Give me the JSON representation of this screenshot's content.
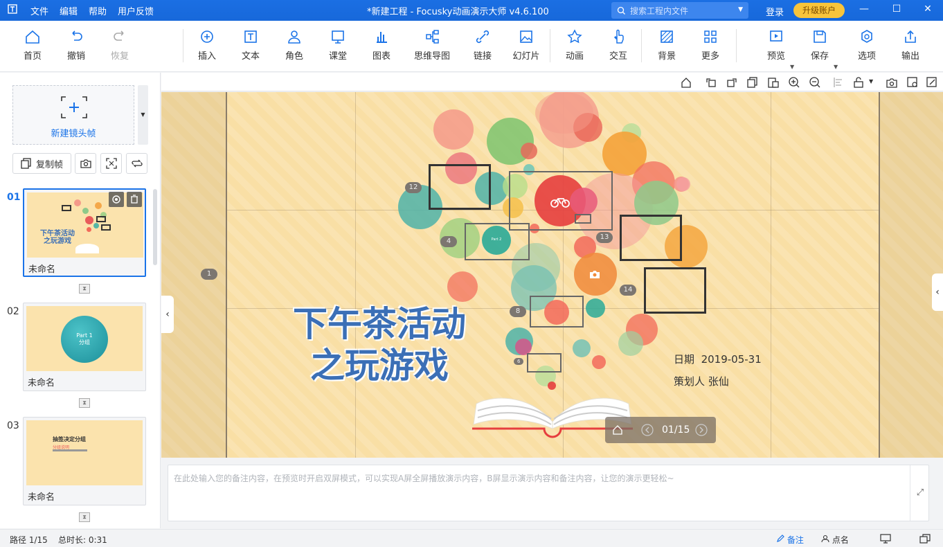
{
  "app": {
    "title": "*新建工程 - Focusky动画演示大师  v4.6.100",
    "menus": [
      "文件",
      "编辑",
      "帮助",
      "用户反馈"
    ],
    "search_placeholder": "搜索工程内文件",
    "login": "登录",
    "upgrade": "升级账户"
  },
  "toolbar": {
    "home": "首页",
    "undo": "撤销",
    "redo": "恢复",
    "insert": "插入",
    "text": "文本",
    "role": "角色",
    "class": "课堂",
    "chart": "图表",
    "mindmap": "思维导图",
    "link": "链接",
    "slides": "幻灯片",
    "animation": "动画",
    "interact": "交互",
    "background": "背景",
    "more": "更多",
    "preview": "预览",
    "save": "保存",
    "options": "选项",
    "export": "输出"
  },
  "left_panel": {
    "new_frame": "新建镜头帧",
    "copy_frame": "复制帧",
    "slides": [
      {
        "num": "01",
        "name": "未命名",
        "thumb_title_1": "下午茶活动",
        "thumb_title_2": "之玩游戏"
      },
      {
        "num": "02",
        "name": "未命名",
        "thumb_title_1": "Part 1",
        "thumb_title_2": "分组"
      },
      {
        "num": "03",
        "name": "未命名",
        "thumb_title_1": "抽签决定分组",
        "thumb_title_2": "分组说明"
      }
    ]
  },
  "stage": {
    "title_line1": "下午茶活动",
    "title_line2": "之玩游戏",
    "date_label": "日期",
    "date_value": "2019-05-31",
    "author_label": "策划人",
    "author_value": "张仙",
    "page_indicator": "01/15",
    "badges": [
      "1",
      "12",
      "4",
      "13",
      "14",
      "8",
      "6"
    ],
    "part_label": "Part 2"
  },
  "notes": {
    "placeholder": "在此处输入您的备注内容，在预览时开启双屏模式，可以实现A屏全屏播放演示内容，B屏显示演示内容和备注内容，让您的演示更轻松~"
  },
  "status": {
    "path": "路径 1/15",
    "duration": "总时长: 0:31",
    "notes_btn": "备注",
    "roll_call": "点名"
  },
  "colors": {
    "accent": "#1a73e8",
    "stage_bg": "#f9dfa5",
    "title_blue": "#3b6fb6",
    "upgrade": "#f8c43b"
  }
}
